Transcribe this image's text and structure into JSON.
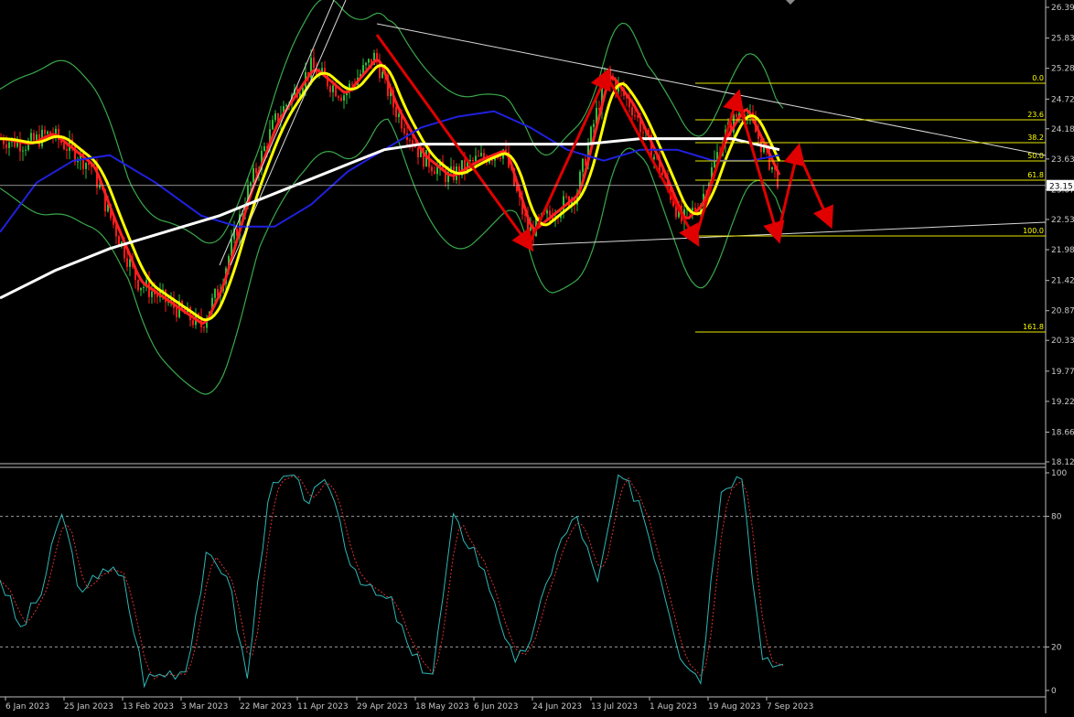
{
  "colors": {
    "background": "#000000",
    "candle_up": "#2dbf3a",
    "candle_down": "#ff1a1a",
    "fast_ma": "#ff2020",
    "mid_ma": "#ffff00",
    "ma_blue": "#2020e0",
    "ma_white": "#ffffff",
    "bollinger": "#3aa84a",
    "fib": "#e8e800",
    "trendline": "#d8d8d8",
    "arrow": "#e00000",
    "stoch_main": "#2fb6b6",
    "stoch_signal": "#e03030",
    "grid_dash": "#9a9a9a",
    "axis_text": "#c8c8c8",
    "price_marker_bg": "#ffffff"
  },
  "price_axis": {
    "ticks": [
      "26.39",
      "25.83",
      "25.28",
      "24.72",
      "24.18",
      "23.63",
      "23.07",
      "22.53",
      "21.98",
      "21.42",
      "20.87",
      "20.33",
      "19.77",
      "19.22",
      "18.66",
      "18.12"
    ],
    "current_price": "23.15"
  },
  "stoch_axis": {
    "ticks": [
      "100",
      "80",
      "20",
      "0"
    ]
  },
  "date_axis": {
    "labels": [
      "6 Jan 2023",
      "25 Jan 2023",
      "13 Feb 2023",
      "3 Mar 2023",
      "22 Mar 2023",
      "11 Apr 2023",
      "29 Apr 2023",
      "18 May 2023",
      "6 Jun 2023",
      "24 Jun 2023",
      "13 Jul 2023",
      "1 Aug 2023",
      "19 Aug 2023",
      "7 Sep 2023"
    ]
  },
  "fibonacci": {
    "levels": [
      "0.0",
      "23.6",
      "38.2",
      "50.0",
      "61.8",
      "100.0",
      "161.8"
    ]
  },
  "chart_data": {
    "type": "line",
    "title": "",
    "panels": [
      {
        "name": "price",
        "ylim": [
          18.12,
          26.39
        ],
        "current_price": 23.15,
        "key_points": [
          {
            "date": "6 Jan 2023",
            "price": 24.0
          },
          {
            "date": "3 Mar 2023",
            "price": 20.1
          },
          {
            "date": "29 Apr 2023",
            "price": 25.9
          },
          {
            "date": "18 Jun 2023",
            "price": 22.2
          },
          {
            "date": "13 Jul 2023",
            "price": 25.2
          },
          {
            "date": "1 Aug 2023",
            "price": 22.3
          },
          {
            "date": "19 Aug 2023",
            "price": 24.7
          },
          {
            "date": "7 Sep 2023",
            "price": 23.1
          }
        ],
        "fibonacci_levels": [
          0.0,
          23.6,
          38.2,
          50.0,
          61.8,
          100.0,
          161.8
        ]
      },
      {
        "name": "stochastic",
        "ylim": [
          0,
          100
        ],
        "levels": [
          80,
          20
        ],
        "series": [
          {
            "values": [
              52,
              28,
              45,
              82,
              42,
              58,
              50,
              5,
              8,
              10,
              60,
              55,
              5,
              90,
              98,
              88,
              95,
              60,
              45,
              40,
              15,
              8,
              78,
              65,
              42,
              10,
              30,
              65,
              80,
              48,
              98,
              88,
              55,
              18,
              5,
              95,
              99,
              12,
              12
            ]
          }
        ]
      }
    ]
  }
}
